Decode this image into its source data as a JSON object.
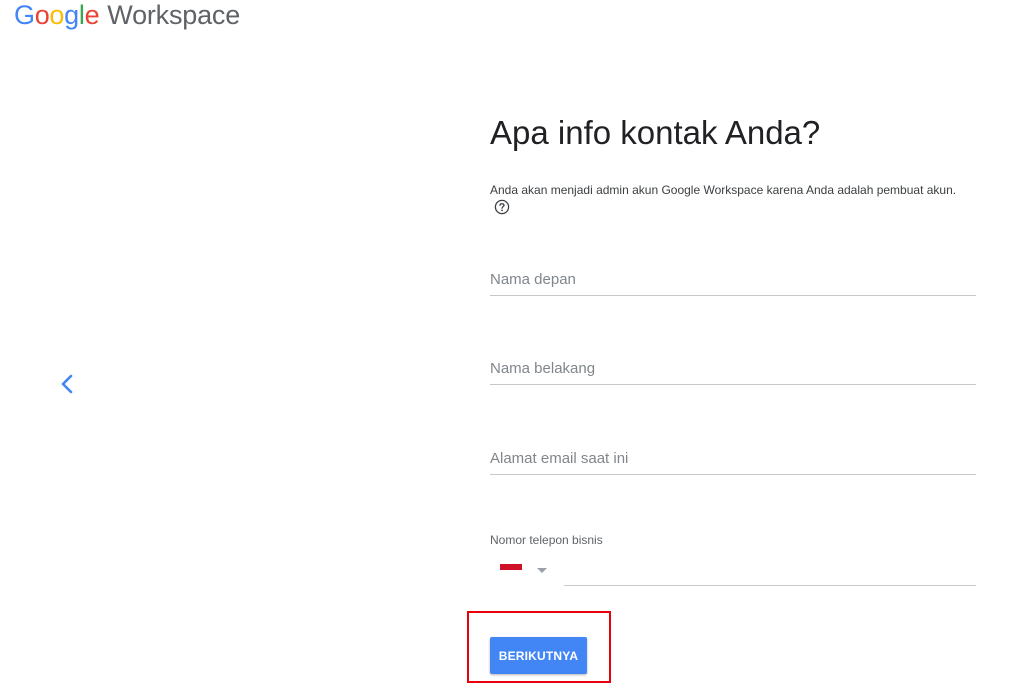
{
  "brand": {
    "logo_letters": [
      "G",
      "o",
      "o",
      "g",
      "l",
      "e"
    ],
    "product_name": "Workspace"
  },
  "nav": {
    "back_icon": "chevron-left-icon"
  },
  "form": {
    "title": "Apa info kontak Anda?",
    "subtitle": "Anda akan menjadi admin akun Google Workspace karena Anda adalah pembuat akun.",
    "help_icon": "help-circle-icon",
    "fields": {
      "first_name": {
        "placeholder": "Nama depan",
        "value": ""
      },
      "last_name": {
        "placeholder": "Nama belakang",
        "value": ""
      },
      "email": {
        "placeholder": "Alamat email saat ini",
        "value": ""
      }
    },
    "phone": {
      "label": "Nomor telepon bisnis",
      "country_flag": "indonesia-flag",
      "value": ""
    },
    "next_button": "BERIKUTNYA"
  },
  "colors": {
    "accent": "#4285F4",
    "highlight": "#e8000b"
  }
}
